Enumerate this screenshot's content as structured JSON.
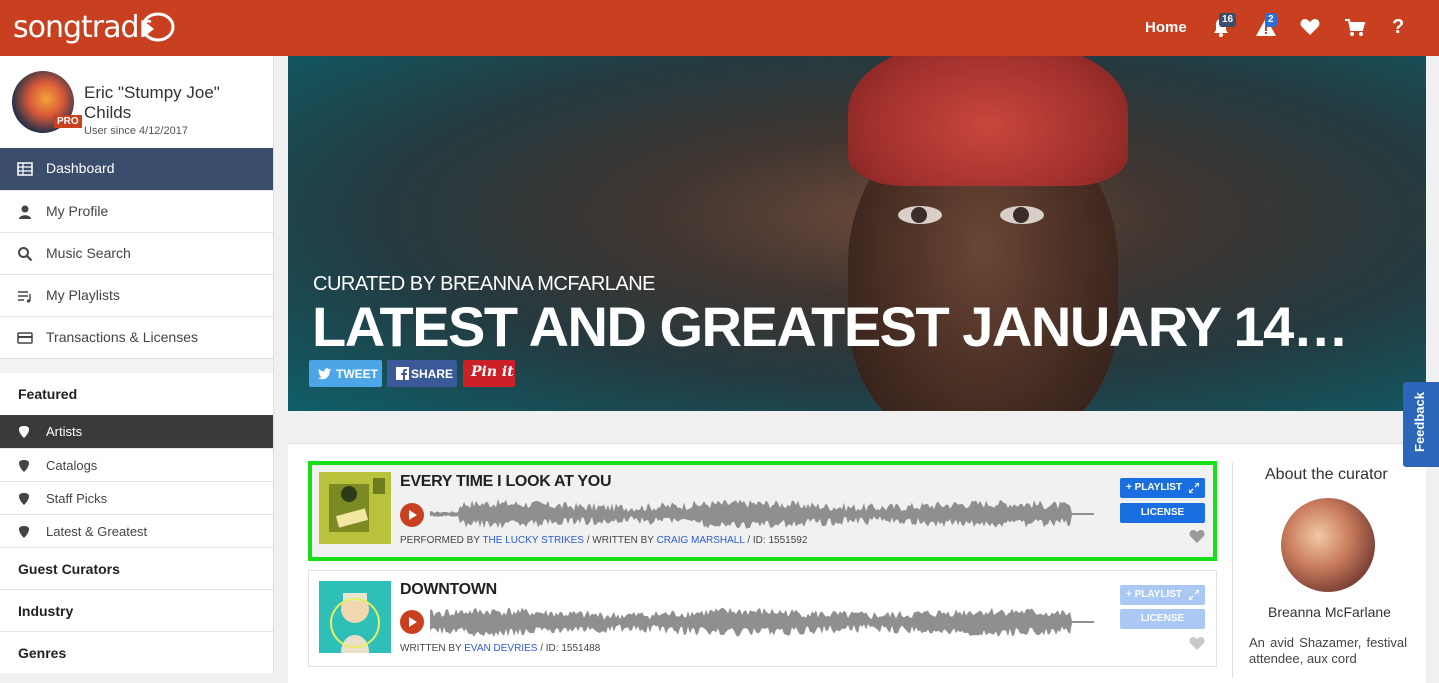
{
  "header": {
    "logo": "songtradr",
    "home_label": "Home",
    "notifications_count": "16",
    "alerts_count": "2",
    "help_label": "?"
  },
  "sidebar": {
    "user_name": "Eric \"Stumpy Joe\" Childs",
    "user_since": "User since 4/12/2017",
    "pro_badge": "PRO",
    "menu": [
      {
        "label": "Dashboard",
        "icon": "grid-icon"
      },
      {
        "label": "My Profile",
        "icon": "person-icon"
      },
      {
        "label": "Music Search",
        "icon": "search-icon"
      },
      {
        "label": "My Playlists",
        "icon": "playlist-icon"
      },
      {
        "label": "Transactions & Licenses",
        "icon": "credit-card-icon"
      }
    ],
    "featured_label": "Featured",
    "featured_items": [
      "Artists",
      "Catalogs",
      "Staff Picks",
      "Latest & Greatest"
    ],
    "sections": [
      "Guest Curators",
      "Industry",
      "Genres"
    ]
  },
  "hero": {
    "subtitle": "CURATED BY BREANNA MCFARLANE",
    "title": "LATEST AND GREATEST JANUARY 14…",
    "tweet_label": "TWEET",
    "share_label": "SHARE",
    "pin_label": "Pin it"
  },
  "tracks": [
    {
      "title": "EVERY TIME I LOOK AT YOU",
      "credit_prefix": "PERFORMED BY",
      "performer": "THE LUCKY STRIKES",
      "writer_prefix": " / WRITTEN BY",
      "writer": "CRAIG MARSHALL",
      "id_text": " / ID: 1551592",
      "playlist_label": "+ PLAYLIST",
      "license_label": "LICENSE"
    },
    {
      "title": "DOWNTOWN",
      "writer_prefix": "WRITTEN BY",
      "writer": "EVAN DEVRIES",
      "id_text": " / ID: 1551488",
      "playlist_label": "+ PLAYLIST",
      "license_label": "LICENSE"
    }
  ],
  "curator": {
    "heading": "About the curator",
    "name": "Breanna McFarlane",
    "bio": "An avid Shazamer, festival attendee, aux cord"
  },
  "feedback_label": "Feedback",
  "colors": {
    "brand": "#c8401f",
    "nav_active": "#3a4d6a",
    "link": "#2a5bd7",
    "button": "#1a6fe0",
    "highlight": "#18e018"
  }
}
